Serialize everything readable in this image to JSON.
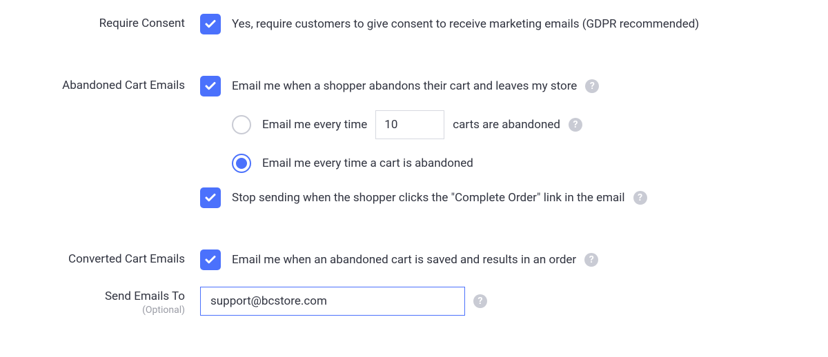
{
  "requireConsent": {
    "label": "Require Consent",
    "text": "Yes, require customers to give consent to receive marketing emails (GDPR recommended)"
  },
  "abandonedCart": {
    "label": "Abandoned Cart Emails",
    "mainText": "Email me when a shopper abandons their cart and leaves my store",
    "radioA_pre": "Email me every time",
    "radioA_value": "10",
    "radioA_post": "carts are abandoned",
    "radioB": "Email me every time a cart is abandoned",
    "stopText": "Stop sending when the shopper clicks the \"Complete Order\" link in the email"
  },
  "convertedCart": {
    "label": "Converted Cart Emails",
    "text": "Email me when an abandoned cart is saved and results in an order"
  },
  "sendTo": {
    "label": "Send Emails To",
    "optional": "(Optional)",
    "value": "support@bcstore.com"
  },
  "helpGlyph": "?"
}
